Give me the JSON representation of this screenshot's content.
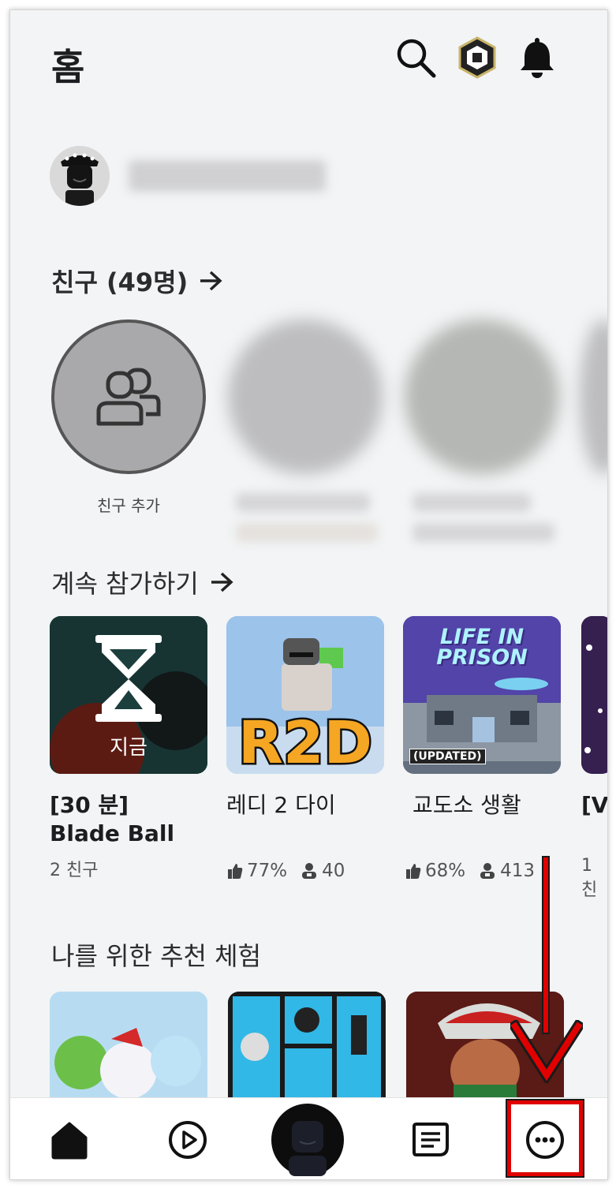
{
  "header": {
    "title": "홈",
    "icons": [
      "search-icon",
      "robux-icon",
      "bell-icon"
    ]
  },
  "friends": {
    "title": "친구 (49명)",
    "add_label": "친구 추가"
  },
  "continue": {
    "title": "계속 참가하기",
    "games": [
      {
        "name": "[30 분]\nBlade Ball",
        "overlay": "지금",
        "meta": "2 친구"
      },
      {
        "name": "레디 2 다이",
        "rating": "77%",
        "players": "40"
      },
      {
        "name": "교도소 생활",
        "rating": "68%",
        "players": "413",
        "badge": "(UPDATED)",
        "logo": "LIFE IN\nPRISON"
      },
      {
        "name": "[V",
        "meta": "1 친"
      }
    ]
  },
  "recommended": {
    "title": "나를 위한 추천 체험"
  },
  "colors": {
    "background": "#f2f4f5",
    "annotation": "#e00000"
  },
  "bottom_nav": [
    "home-icon",
    "play-icon",
    "avatar-icon",
    "chat-icon",
    "more-icon"
  ]
}
